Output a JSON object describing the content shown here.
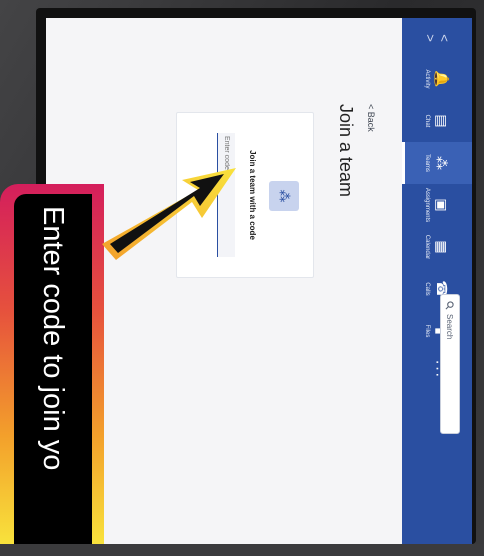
{
  "nav": {
    "arrow_left": "<",
    "arrow_right": ">",
    "items": [
      {
        "label": "Activity",
        "icon": "bell-icon",
        "glyph": "🔔"
      },
      {
        "label": "Chat",
        "icon": "chat-icon",
        "glyph": "▤"
      },
      {
        "label": "Teams",
        "icon": "teams-icon",
        "glyph": "⁂"
      },
      {
        "label": "Assignments",
        "icon": "assignments-icon",
        "glyph": "▣"
      },
      {
        "label": "Calendar",
        "icon": "calendar-icon",
        "glyph": "▦"
      },
      {
        "label": "Calls",
        "icon": "phone-icon",
        "glyph": "☎"
      },
      {
        "label": "Files",
        "icon": "file-icon",
        "glyph": "▮"
      }
    ],
    "more": "···",
    "active": "Teams"
  },
  "search": {
    "placeholder": "Search",
    "icon": "search-icon"
  },
  "page": {
    "back_label": "< Back",
    "title": "Join a team"
  },
  "join_card": {
    "title": "Join a team with a code",
    "icon": "teams-icon",
    "input_placeholder": "Enter code"
  },
  "overlay": {
    "caption": "Enter code to join yo",
    "arrow_icon": "arrow-pointer-icon"
  },
  "colors": {
    "rail": "#2a4fa1",
    "accent": "#2a4fa1"
  }
}
